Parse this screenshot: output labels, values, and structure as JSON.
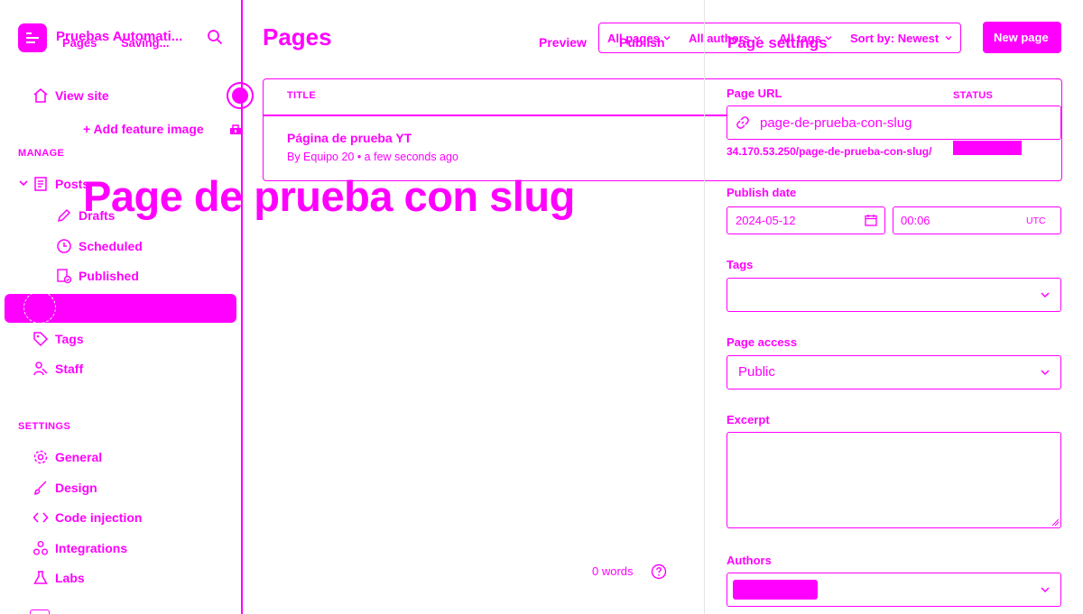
{
  "site": {
    "title": "Pruebas Automati...",
    "brand_color": "#ff00ff"
  },
  "editor": {
    "breadcrumb_parent": "Pages",
    "save_status": "Saving...",
    "title": "Page de prueba con slug",
    "add_feature_image": "+ Add feature image",
    "preview": "Preview",
    "publish": "Publish",
    "word_count": "0 words"
  },
  "sidebar": {
    "view_site": "View site",
    "manage_heading": "MANAGE",
    "posts": "Posts",
    "drafts": "Drafts",
    "scheduled": "Scheduled",
    "published": "Published",
    "tags": "Tags",
    "staff": "Staff",
    "settings_heading": "SETTINGS",
    "general": "General",
    "design": "Design",
    "code_injection": "Code injection",
    "integrations": "Integrations",
    "labs": "Labs"
  },
  "pages_list": {
    "heading": "Pages",
    "filters": [
      "All pages",
      "All authors",
      "All tags",
      "Sort by: Newest"
    ],
    "new_button": "New page",
    "columns": {
      "title": "TITLE",
      "status": "STATUS"
    },
    "rows": [
      {
        "title": "Página de prueba YT",
        "meta": "By Equipo 20 • a few seconds ago"
      }
    ]
  },
  "settings_panel": {
    "title": "Page settings",
    "url_label": "Page URL",
    "url_value": "page-de-prueba-con-slug",
    "url_preview": "34.170.53.250/page-de-prueba-con-slug/",
    "publish_date_label": "Publish date",
    "date_value": "2024-05-12",
    "time_value": "00:06",
    "timezone": "UTC",
    "tags_label": "Tags",
    "access_label": "Page access",
    "access_value": "Public",
    "excerpt_label": "Excerpt",
    "authors_label": "Authors"
  }
}
